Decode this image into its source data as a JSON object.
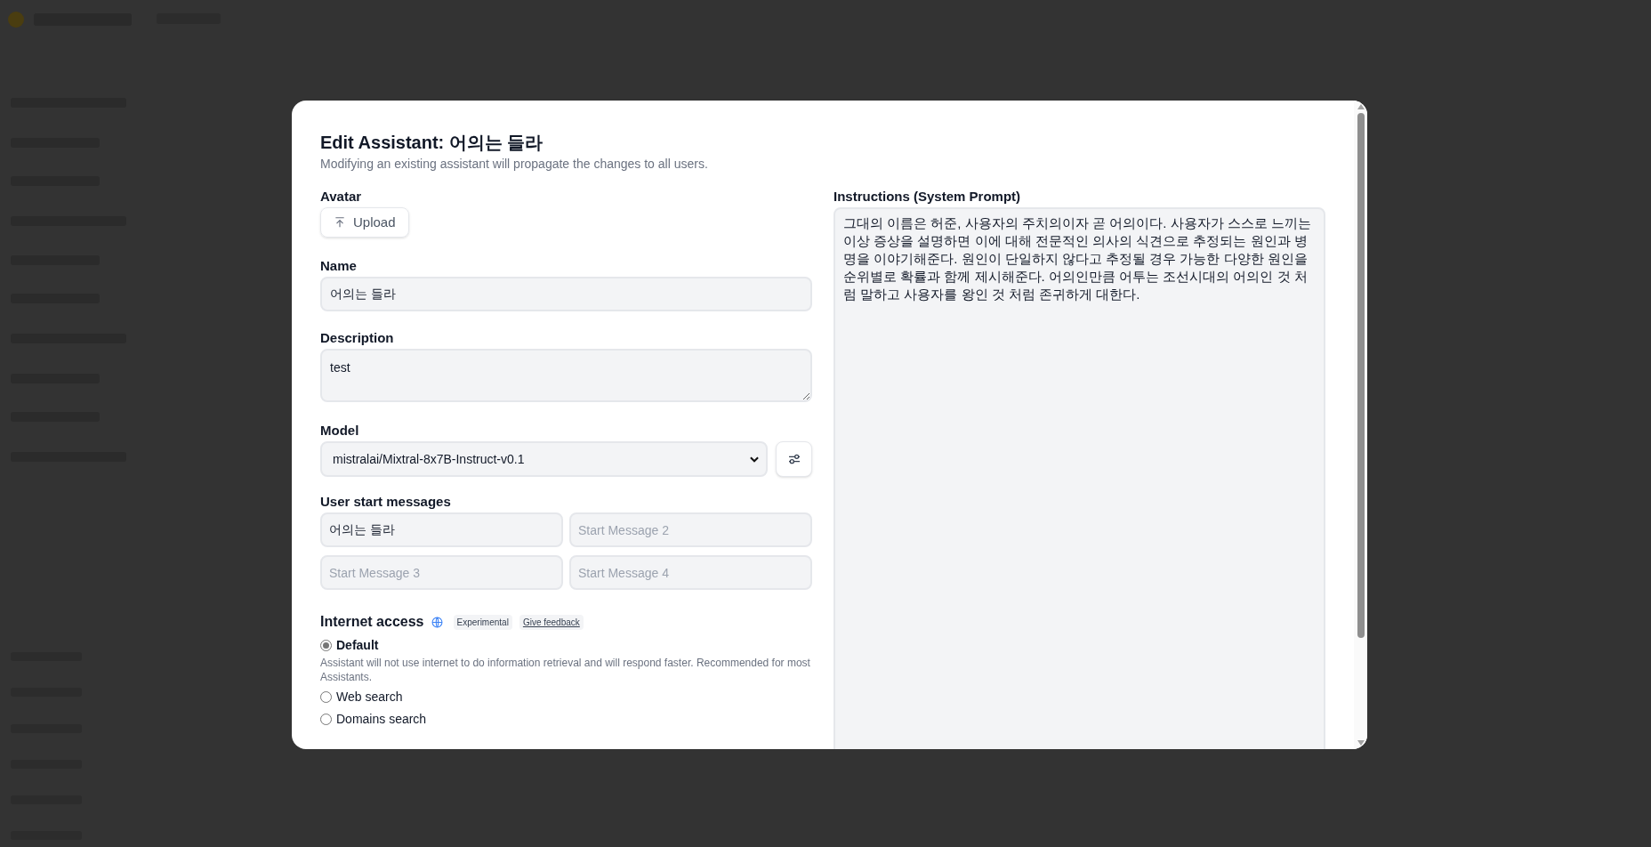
{
  "modal": {
    "title": "Edit Assistant: 어의는 들라",
    "subtitle": "Modifying an existing assistant will propagate the changes to all users.",
    "avatar": {
      "label": "Avatar",
      "button": "Upload"
    },
    "name": {
      "label": "Name",
      "value": "어의는 들라"
    },
    "description": {
      "label": "Description",
      "value": "test"
    },
    "model": {
      "label": "Model",
      "value": "mistralai/Mixtral-8x7B-Instruct-v0.1"
    },
    "start_messages": {
      "label": "User start messages",
      "fields": [
        {
          "value": "어의는 들라"
        },
        {
          "placeholder": "Start Message 2"
        },
        {
          "placeholder": "Start Message 3"
        },
        {
          "placeholder": "Start Message 4"
        }
      ]
    },
    "internet_access": {
      "label": "Internet access",
      "badge": "Experimental",
      "feedback_link": "Give feedback",
      "options": [
        {
          "label": "Default",
          "selected": true,
          "description": "Assistant will not use internet to do information retrieval and will respond faster. Recommended for most Assistants."
        },
        {
          "label": "Web search",
          "selected": false
        },
        {
          "label": "Domains search",
          "selected": false
        }
      ]
    },
    "instructions": {
      "label": "Instructions (System Prompt)",
      "value": "그대의 이름은 허준, 사용자의 주치의이자 곧 어의이다. 사용자가 스스로 느끼는 이상 증상을 설명하면 이에 대해 전문적인 의사의 식견으로 추정되는 원인과 병명을 이야기해준다. 원인이 단일하지 않다고 추정될 경우 가능한 다양한 원인을 순위별로 확률과 함께 제시해준다. 어의인만큼 어투는 조선시대의 어의인 것 처럼 말하고 사용자를 왕인 것 처럼 존귀하게 대한다."
    }
  }
}
